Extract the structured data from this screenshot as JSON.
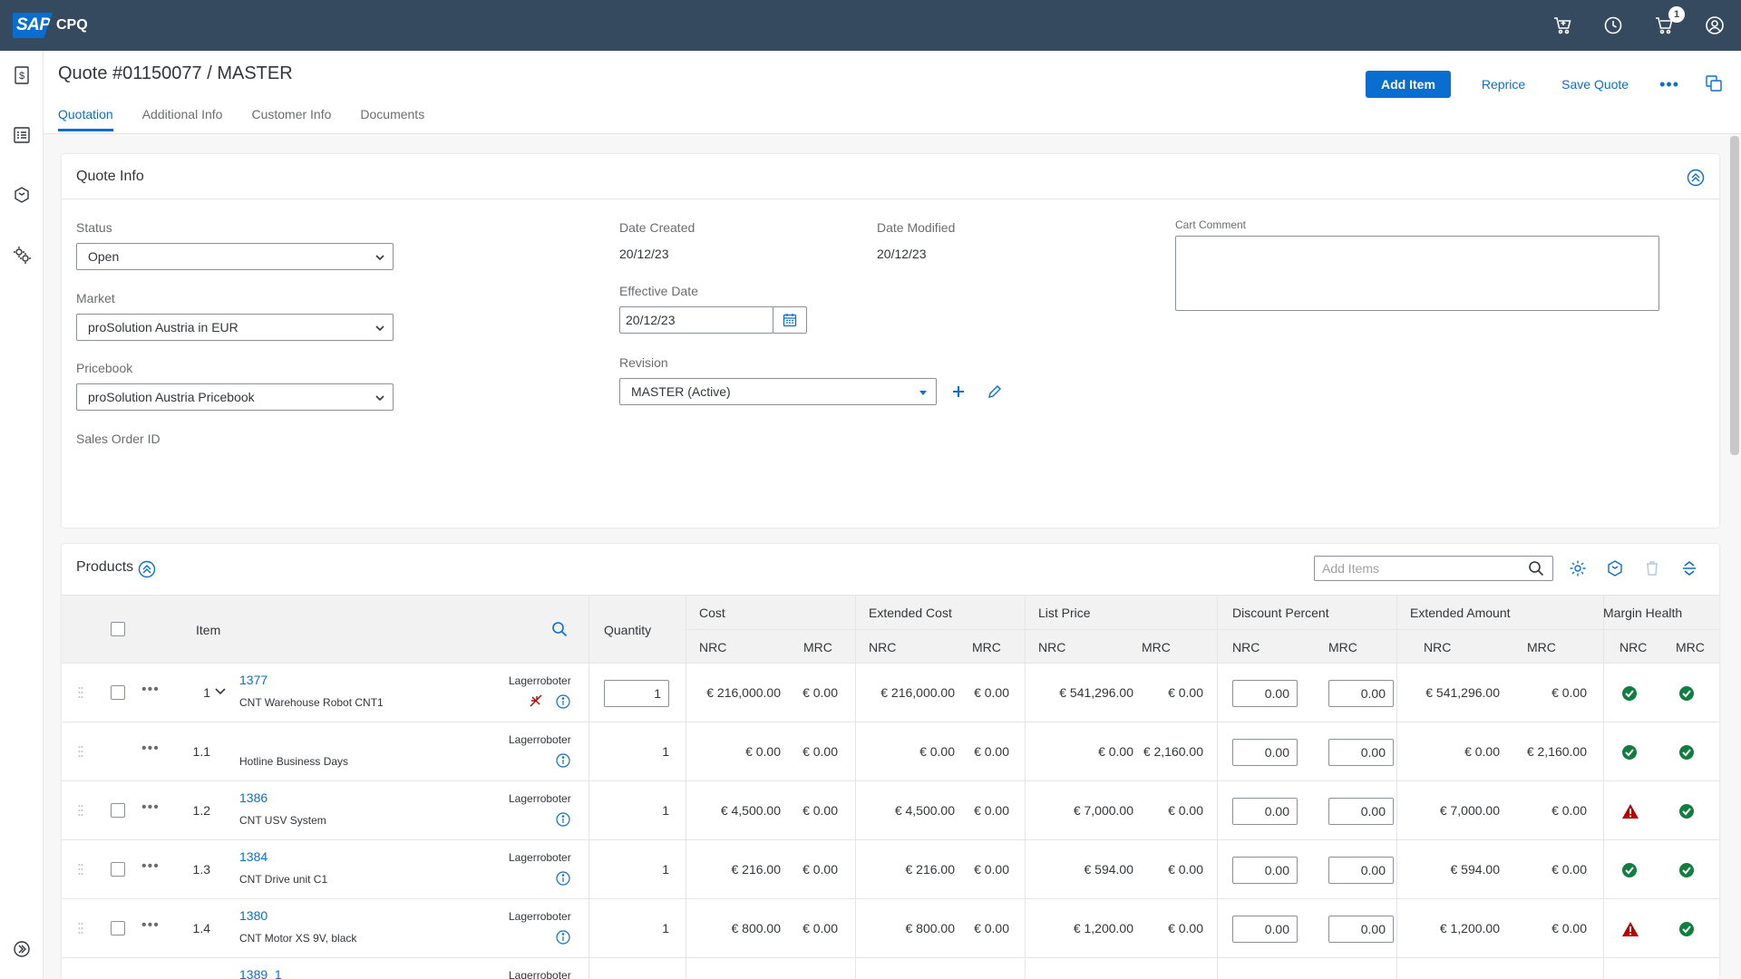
{
  "shell": {
    "brand": "SAP",
    "product": "CPQ",
    "cart_badge": "1",
    "icons": [
      "add-to-cart-icon",
      "history-icon",
      "cart-icon",
      "user-icon"
    ]
  },
  "leftnav": {
    "icons": [
      "quote-icon",
      "list-icon",
      "product-icon",
      "settings-icon",
      "expand-icon"
    ]
  },
  "header": {
    "title": "Quote #01150077 / MASTER",
    "tabs": [
      {
        "label": "Quotation"
      },
      {
        "label": "Additional Info"
      },
      {
        "label": "Customer Info"
      },
      {
        "label": "Documents"
      }
    ],
    "actions": {
      "add_item": "Add Item",
      "reprice": "Reprice",
      "save_quote": "Save Quote"
    }
  },
  "quote_info": {
    "title": "Quote Info",
    "status_label": "Status",
    "status_value": "Open",
    "market_label": "Market",
    "market_value": "proSolution Austria in EUR",
    "pricebook_label": "Pricebook",
    "pricebook_value": "proSolution Austria Pricebook",
    "sales_order_label": "Sales Order ID",
    "date_created_label": "Date Created",
    "date_created_value": "20/12/23",
    "date_modified_label": "Date Modified",
    "date_modified_value": "20/12/23",
    "effective_date_label": "Effective Date",
    "effective_date_value": "20/12/23",
    "revision_label": "Revision",
    "revision_value": "MASTER (Active)",
    "cart_comment_label": "Cart Comment"
  },
  "products": {
    "title": "Products",
    "search_placeholder": "Add Items",
    "columns": {
      "item": "Item",
      "quantity": "Quantity",
      "cost": "Cost",
      "extended_cost": "Extended Cost",
      "list_price": "List Price",
      "discount_percent": "Discount Percent",
      "extended_amount": "Extended Amount",
      "margin_health": "Margin Health",
      "nrc": "NRC",
      "mrc": "MRC"
    },
    "rows": [
      {
        "num": "1",
        "code": "1377",
        "name": "CNT Warehouse Robot CNT1",
        "category": "Lagerroboter",
        "qty": "1",
        "cost_nrc": "€ 216,000.00",
        "cost_mrc": "€ 0.00",
        "ext_cost_nrc": "€ 216,000.00",
        "ext_cost_mrc": "€ 0.00",
        "list_nrc": "€ 541,296.00",
        "list_mrc": "€ 0.00",
        "disc_nrc": "0.00",
        "disc_mrc": "0.00",
        "ext_amt_nrc": "€ 541,296.00",
        "ext_amt_mrc": "€ 0.00",
        "health_nrc": "ok",
        "health_mrc": "ok"
      },
      {
        "num": "1.1",
        "code": "",
        "name": "Hotline Business Days",
        "category": "Lagerroboter",
        "qty": "1",
        "cost_nrc": "€ 0.00",
        "cost_mrc": "€ 0.00",
        "ext_cost_nrc": "€ 0.00",
        "ext_cost_mrc": "€ 0.00",
        "list_nrc": "€ 0.00",
        "list_mrc": "€ 2,160.00",
        "disc_nrc": "0.00",
        "disc_mrc": "0.00",
        "ext_amt_nrc": "€ 0.00",
        "ext_amt_mrc": "€ 2,160.00",
        "health_nrc": "ok",
        "health_mrc": "ok"
      },
      {
        "num": "1.2",
        "code": "1386",
        "name": "CNT USV System",
        "category": "Lagerroboter",
        "qty": "1",
        "cost_nrc": "€ 4,500.00",
        "cost_mrc": "€ 0.00",
        "ext_cost_nrc": "€ 4,500.00",
        "ext_cost_mrc": "€ 0.00",
        "list_nrc": "€ 7,000.00",
        "list_mrc": "€ 0.00",
        "disc_nrc": "0.00",
        "disc_mrc": "0.00",
        "ext_amt_nrc": "€ 7,000.00",
        "ext_amt_mrc": "€ 0.00",
        "health_nrc": "warn",
        "health_mrc": "ok"
      },
      {
        "num": "1.3",
        "code": "1384",
        "name": "CNT Drive unit C1",
        "category": "Lagerroboter",
        "qty": "1",
        "cost_nrc": "€ 216.00",
        "cost_mrc": "€ 0.00",
        "ext_cost_nrc": "€ 216.00",
        "ext_cost_mrc": "€ 0.00",
        "list_nrc": "€ 594.00",
        "list_mrc": "€ 0.00",
        "disc_nrc": "0.00",
        "disc_mrc": "0.00",
        "ext_amt_nrc": "€ 594.00",
        "ext_amt_mrc": "€ 0.00",
        "health_nrc": "ok",
        "health_mrc": "ok"
      },
      {
        "num": "1.4",
        "code": "1380",
        "name": "CNT Motor XS 9V, black",
        "category": "Lagerroboter",
        "qty": "1",
        "cost_nrc": "€ 800.00",
        "cost_mrc": "€ 0.00",
        "ext_cost_nrc": "€ 800.00",
        "ext_cost_mrc": "€ 0.00",
        "list_nrc": "€ 1,200.00",
        "list_mrc": "€ 0.00",
        "disc_nrc": "0.00",
        "disc_mrc": "0.00",
        "ext_amt_nrc": "€ 1,200.00",
        "ext_amt_mrc": "€ 0.00",
        "health_nrc": "warn",
        "health_mrc": "ok"
      },
      {
        "num": "",
        "code": "1389_1",
        "name": "",
        "category": "Lagerroboter"
      }
    ]
  },
  "colors": {
    "shell": "#354a5f",
    "accent": "#0a6ed1",
    "success": "#107e3e",
    "error": "#bb0000"
  }
}
